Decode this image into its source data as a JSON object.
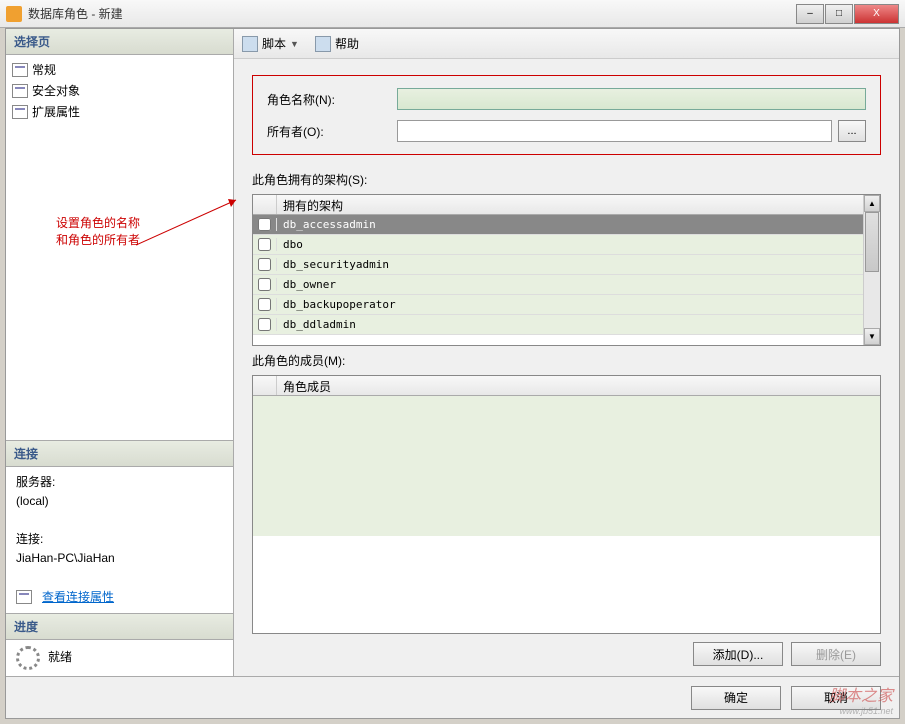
{
  "window": {
    "title": "数据库角色 - 新建",
    "minimize": "–",
    "maximize": "□",
    "close": "X"
  },
  "sidebar": {
    "select_page_header": "选择页",
    "items": [
      {
        "label": "常规"
      },
      {
        "label": "安全对象"
      },
      {
        "label": "扩展属性"
      }
    ],
    "annotation_line1": "设置角色的名称",
    "annotation_line2": "和角色的所有者",
    "connection_header": "连接",
    "server_label": "服务器:",
    "server_value": "(local)",
    "conn_label": "连接:",
    "conn_value": "JiaHan-PC\\JiaHan",
    "view_props": "查看连接属性",
    "progress_header": "进度",
    "progress_status": "就绪"
  },
  "toolbar": {
    "script": "脚本",
    "help": "帮助"
  },
  "form": {
    "role_name_label": "角色名称(N):",
    "role_name_value": "",
    "owner_label": "所有者(O):",
    "owner_value": "",
    "browse": "..."
  },
  "schemas": {
    "section_label": "此角色拥有的架构(S):",
    "column_header": "拥有的架构",
    "rows": [
      {
        "name": "db_accessadmin",
        "checked": false,
        "selected": true
      },
      {
        "name": "dbo",
        "checked": false,
        "selected": false
      },
      {
        "name": "db_securityadmin",
        "checked": false,
        "selected": false
      },
      {
        "name": "db_owner",
        "checked": false,
        "selected": false
      },
      {
        "name": "db_backupoperator",
        "checked": false,
        "selected": false
      },
      {
        "name": "db_ddladmin",
        "checked": false,
        "selected": false
      }
    ]
  },
  "members": {
    "section_label": "此角色的成员(M):",
    "column_header": "角色成员",
    "add_btn": "添加(D)...",
    "remove_btn": "删除(E)"
  },
  "footer": {
    "ok": "确定",
    "cancel": "取消"
  },
  "watermark": {
    "main": "脚本之家",
    "sub": "www.jb51.net"
  }
}
